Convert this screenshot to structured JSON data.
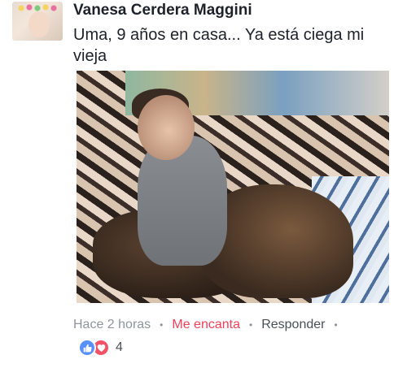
{
  "post": {
    "author": "Vanesa Cerdera Maggini",
    "text": "Uma, 9 años en casa... Ya está ciega mi vieja",
    "photo_icon": "photo",
    "avatar_icon": "profile-photo"
  },
  "actions": {
    "time": "Hace 2 horas",
    "separator": "•",
    "love_label": "Me encanta",
    "reply_label": "Responder"
  },
  "reactions": {
    "icons": [
      "like-icon",
      "love-icon"
    ],
    "count": "4"
  },
  "colors": {
    "love": "#f33e58",
    "like": "#5890ff",
    "meta": "#90949c"
  }
}
